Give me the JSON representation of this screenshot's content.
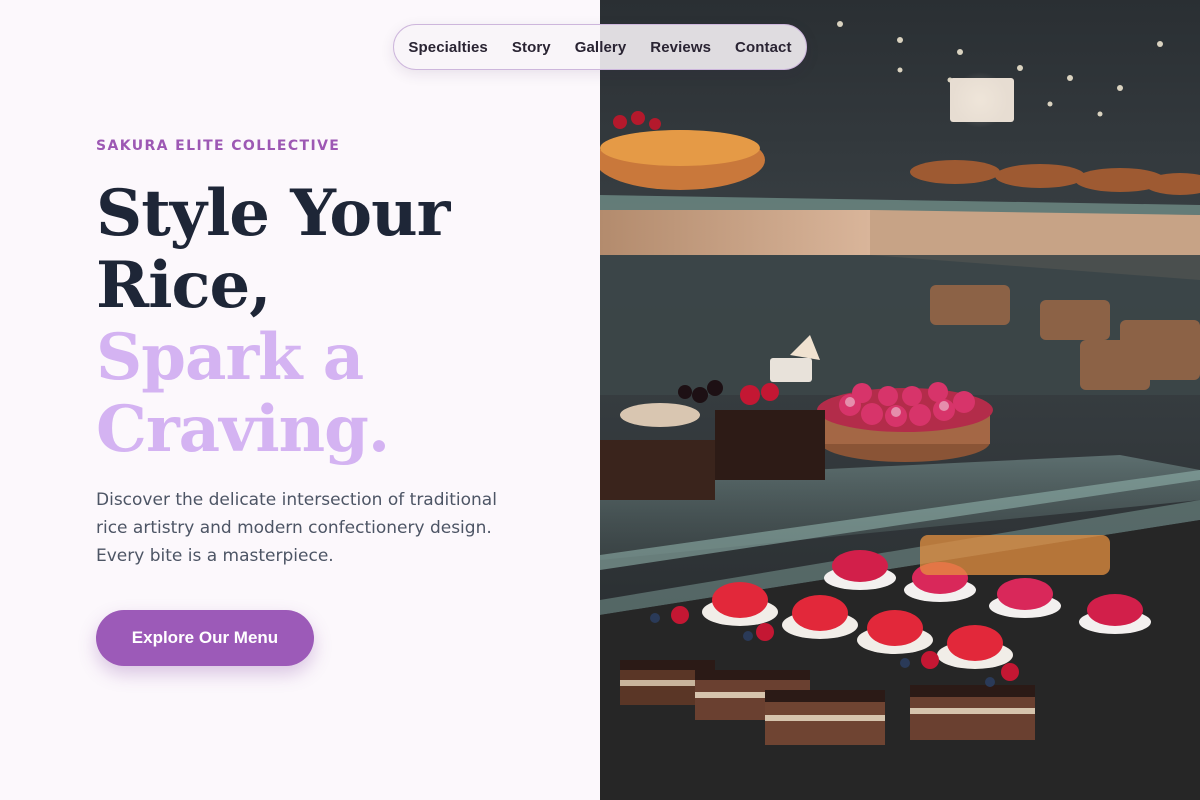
{
  "nav": {
    "items": [
      "Specialties",
      "Story",
      "Gallery",
      "Reviews",
      "Contact"
    ]
  },
  "hero": {
    "eyebrow": "SAKURA ELITE COLLECTIVE",
    "headline_line1": "Style Your",
    "headline_line2": "Rice,",
    "headline_line3": "Spark a",
    "headline_line4": "Craving.",
    "description": "Discover the delicate intersection of traditional rice artistry and modern confectionery design. Every bite is a masterpiece.",
    "cta_label": "Explore Our Menu"
  },
  "colors": {
    "accent": "#9c5ab8",
    "headline_dark": "#1e2637",
    "headline_light": "#d4b3f2",
    "eyebrow": "#9d58b4",
    "background": "#fcf8fc"
  },
  "image": {
    "icon": "pastry-display-case-photo"
  }
}
